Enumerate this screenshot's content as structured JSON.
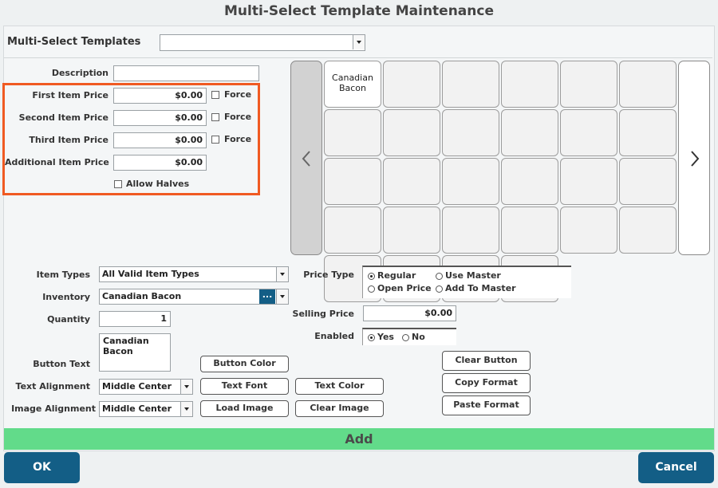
{
  "window": {
    "title": "Multi-Select Template Maintenance"
  },
  "templates": {
    "label": "Multi-Select Templates",
    "value": ""
  },
  "description": {
    "label": "Description",
    "value": ""
  },
  "prices": {
    "first_label": "First Item Price",
    "first_value": "$0.00",
    "second_label": "Second Item Price",
    "second_value": "$0.00",
    "third_label": "Third Item Price",
    "third_value": "$0.00",
    "additional_label": "Additional Item Price",
    "additional_value": "$0.00",
    "force_label": "Force",
    "allow_halves_label": "Allow Halves"
  },
  "grid": {
    "buttons": [
      "Canadian\nBacon",
      "",
      "",
      "",
      "",
      "",
      "",
      "",
      "",
      "",
      "",
      "",
      "",
      "",
      "",
      "",
      "",
      "",
      "",
      "",
      "",
      "",
      "",
      "",
      "",
      "",
      "",
      ""
    ]
  },
  "form": {
    "item_types_label": "Item Types",
    "item_types_value": "All Valid Item Types",
    "inventory_label": "Inventory",
    "inventory_value": "Canadian Bacon",
    "inventory_lookup": "...",
    "quantity_label": "Quantity",
    "quantity_value": "1",
    "button_text_label": "Button Text",
    "button_text_value": "Canadian\nBacon",
    "text_alignment_label": "Text Alignment",
    "text_alignment_value": "Middle Center",
    "image_alignment_label": "Image Alignment",
    "image_alignment_value": "Middle Center",
    "price_type_label": "Price Type",
    "price_type_options": [
      "Regular",
      "Use Master",
      "Open Price",
      "Add To Master"
    ],
    "price_type_selected": "Regular",
    "selling_price_label": "Selling Price",
    "selling_price_value": "$0.00",
    "enabled_label": "Enabled",
    "enabled_options": [
      "Yes",
      "No"
    ],
    "enabled_selected": "Yes"
  },
  "buttons": {
    "button_color": "Button Color",
    "text_font": "Text Font",
    "text_color": "Text Color",
    "load_image": "Load Image",
    "clear_image": "Clear Image",
    "clear_button": "Clear Button",
    "copy_format": "Copy Format",
    "paste_format": "Paste Format",
    "add": "Add",
    "ok": "OK",
    "cancel": "Cancel"
  },
  "colors": {
    "highlight": "#f05a22",
    "add_bar": "#62db8a",
    "primary": "#135e86"
  }
}
